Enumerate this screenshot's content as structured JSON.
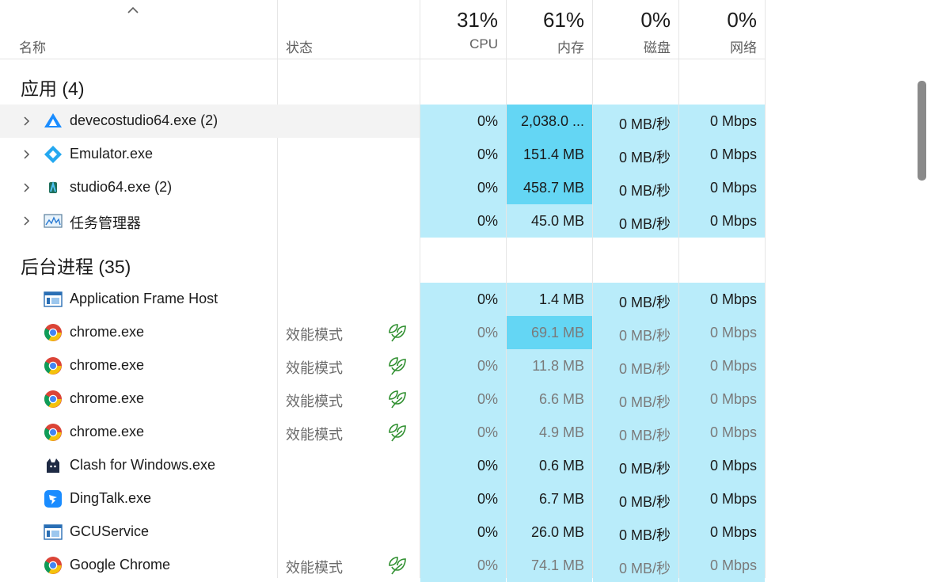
{
  "header": {
    "name_label": "名称",
    "status_label": "状态",
    "cpu_pct": "31%",
    "cpu_label": "CPU",
    "mem_pct": "61%",
    "mem_label": "内存",
    "disk_pct": "0%",
    "disk_label": "磁盘",
    "net_pct": "0%",
    "net_label": "网络"
  },
  "groups": {
    "apps": "应用 (4)",
    "background": "后台进程 (35)"
  },
  "apps": [
    {
      "name": "devecostudio64.exe (2)",
      "icon": "deveco-icon",
      "status": "",
      "cpu": "0%",
      "mem": "2,038.0 ...",
      "disk": "0 MB/秒",
      "net": "0 Mbps"
    },
    {
      "name": "Emulator.exe",
      "icon": "emulator-icon",
      "status": "",
      "cpu": "0%",
      "mem": "151.4 MB",
      "disk": "0 MB/秒",
      "net": "0 Mbps"
    },
    {
      "name": "studio64.exe (2)",
      "icon": "android-studio-icon",
      "status": "",
      "cpu": "0%",
      "mem": "458.7 MB",
      "disk": "0 MB/秒",
      "net": "0 Mbps"
    },
    {
      "name": "任务管理器",
      "icon": "task-manager-icon",
      "status": "",
      "cpu": "0%",
      "mem": "45.0 MB",
      "disk": "0 MB/秒",
      "net": "0 Mbps"
    }
  ],
  "background": [
    {
      "name": "Application Frame Host",
      "icon": "app-frame-icon",
      "status": "",
      "cpu": "0%",
      "mem": "1.4 MB",
      "disk": "0 MB/秒",
      "net": "0 Mbps"
    },
    {
      "name": "chrome.exe",
      "icon": "chrome-icon",
      "status": "效能模式",
      "cpu": "0%",
      "mem": "69.1 MB",
      "disk": "0 MB/秒",
      "net": "0 Mbps"
    },
    {
      "name": "chrome.exe",
      "icon": "chrome-icon",
      "status": "效能模式",
      "cpu": "0%",
      "mem": "11.8 MB",
      "disk": "0 MB/秒",
      "net": "0 Mbps"
    },
    {
      "name": "chrome.exe",
      "icon": "chrome-icon",
      "status": "效能模式",
      "cpu": "0%",
      "mem": "6.6 MB",
      "disk": "0 MB/秒",
      "net": "0 Mbps"
    },
    {
      "name": "chrome.exe",
      "icon": "chrome-icon",
      "status": "效能模式",
      "cpu": "0%",
      "mem": "4.9 MB",
      "disk": "0 MB/秒",
      "net": "0 Mbps"
    },
    {
      "name": "Clash for Windows.exe",
      "icon": "clash-icon",
      "status": "",
      "cpu": "0%",
      "mem": "0.6 MB",
      "disk": "0 MB/秒",
      "net": "0 Mbps"
    },
    {
      "name": "DingTalk.exe",
      "icon": "dingtalk-icon",
      "status": "",
      "cpu": "0%",
      "mem": "6.7 MB",
      "disk": "0 MB/秒",
      "net": "0 Mbps"
    },
    {
      "name": "GCUService",
      "icon": "service-icon",
      "status": "",
      "cpu": "0%",
      "mem": "26.0 MB",
      "disk": "0 MB/秒",
      "net": "0 Mbps"
    },
    {
      "name": "Google Chrome",
      "icon": "chrome-icon",
      "status": "效能模式",
      "cpu": "0%",
      "mem": "74.1 MB",
      "disk": "0 MB/秒",
      "net": "0 Mbps"
    }
  ],
  "colors": {
    "metric_bg": "#b9ecfa",
    "metric_highlight": "#64d6f4",
    "efficiency_leaf": "#2f8f2f"
  }
}
